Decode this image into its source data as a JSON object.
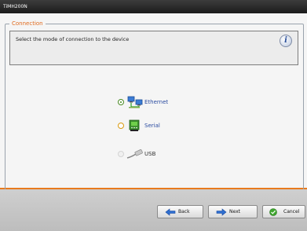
{
  "window": {
    "title": "TiMH200N"
  },
  "group": {
    "legend": "Connection"
  },
  "info": {
    "text": "Select the mode of connection to the device",
    "icon": "info-icon"
  },
  "options": [
    {
      "label": "Ethernet",
      "icon": "ethernet-network-icon",
      "selected": true,
      "enabled": true
    },
    {
      "label": "Serial",
      "icon": "serial-port-icon",
      "selected": false,
      "enabled": true
    },
    {
      "label": "USB",
      "icon": "usb-cable-icon",
      "selected": false,
      "enabled": false
    }
  ],
  "buttons": {
    "back": "Back",
    "next": "Next",
    "cancel": "Cancel"
  },
  "colors": {
    "accent": "#e87a1e",
    "link": "#2a4ba0",
    "titlebar": "#2a2a2a"
  }
}
